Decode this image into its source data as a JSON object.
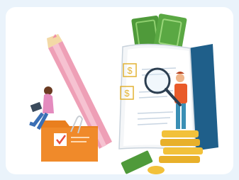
{
  "illustration": {
    "subject": "finance-audit-illustration",
    "currency_symbol": "$",
    "colors": {
      "background": "#eaf3fb",
      "card": "#ffffff",
      "money_green": "#4f9a3a",
      "book_blue": "#1f5f8a",
      "pencil_pink": "#ee9fb6",
      "folder_orange": "#f08a2a",
      "coin_gold": "#f2c13a"
    },
    "icons": [
      "money-bills-icon",
      "book-icon",
      "magnifier-icon",
      "pencil-icon",
      "folder-icon",
      "checkbox-icon",
      "paperclip-icon",
      "coin-stack-icon"
    ]
  }
}
